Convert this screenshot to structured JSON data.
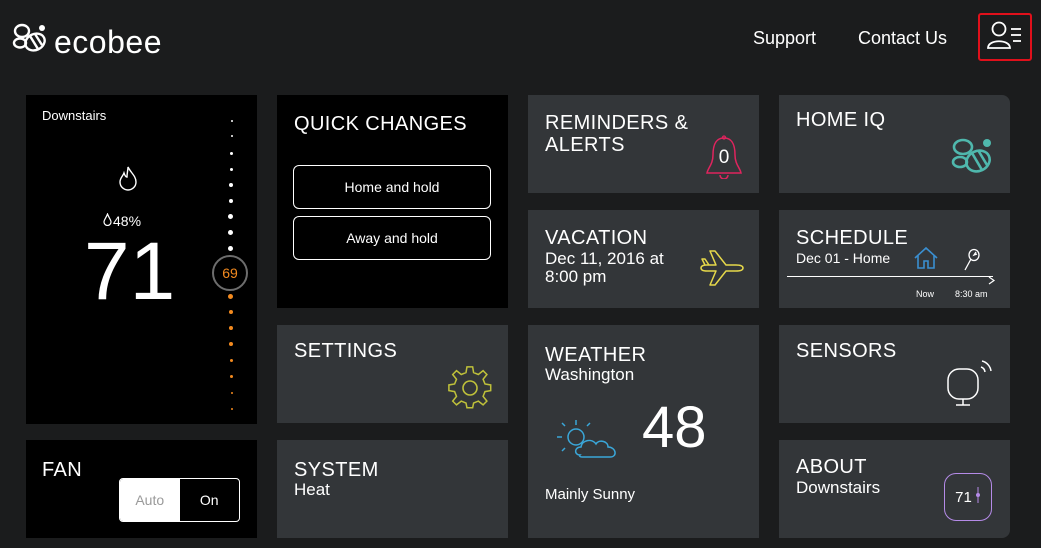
{
  "header": {
    "logo_text": "ecobee",
    "nav": {
      "support": "Support",
      "contact": "Contact Us"
    }
  },
  "thermostat": {
    "location": "Downstairs",
    "humidity": "48%",
    "current_temp": "71",
    "setpoint": "69"
  },
  "quick_changes": {
    "title": "QUICK CHANGES",
    "buttons": [
      "Home and hold",
      "Away and hold"
    ]
  },
  "reminders": {
    "title_line1": "REMINDERS &",
    "title_line2": "ALERTS",
    "count": "0"
  },
  "home_iq": {
    "title": "HOME IQ"
  },
  "vacation": {
    "title": "VACATION",
    "line1": "Dec 11, 2016 at",
    "line2": "8:00 pm"
  },
  "schedule": {
    "title": "SCHEDULE",
    "subtitle": "Dec 01 - Home",
    "now_label": "Now",
    "next_time": "8:30 am"
  },
  "settings": {
    "title": "SETTINGS"
  },
  "weather": {
    "title": "WEATHER",
    "city": "Washington",
    "temp": "48",
    "condition": "Mainly Sunny"
  },
  "sensors": {
    "title": "SENSORS"
  },
  "fan": {
    "title": "FAN",
    "options": [
      "Auto",
      "On"
    ],
    "selected": "Auto"
  },
  "system": {
    "title": "SYSTEM",
    "mode": "Heat"
  },
  "about": {
    "title": "ABOUT",
    "subtitle": "Downstairs",
    "badge": "71"
  },
  "colors": {
    "accent_orange": "#f38a1f",
    "alert_red": "#e0245e",
    "home_iq_teal": "#4fb8ad",
    "vacation_yellow": "#e6d84a",
    "settings_olive": "#bfc13a",
    "schedule_blue": "#3a8fd1",
    "weather_blue": "#3aa7d9",
    "about_purple": "#b58be8"
  }
}
